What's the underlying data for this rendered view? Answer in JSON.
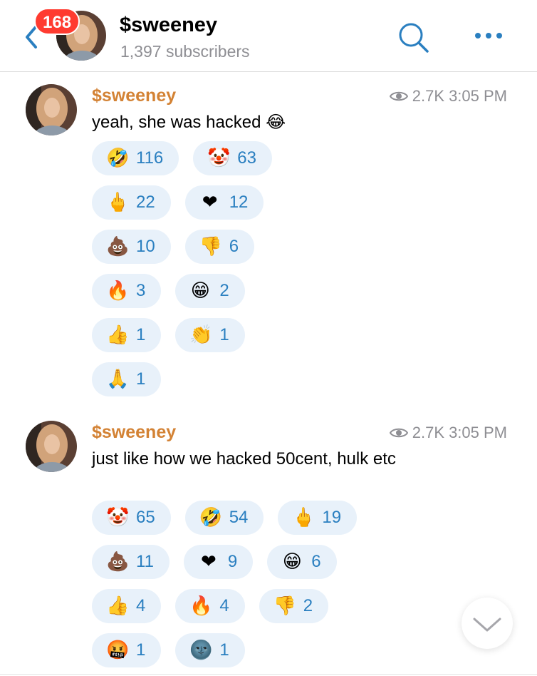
{
  "header": {
    "badge_count": "168",
    "title": "$sweeney",
    "subscribers": "1,397 subscribers"
  },
  "colors": {
    "accent_blue": "#2a7fc0",
    "author_orange": "#d38234",
    "badge_red": "#ff3b30",
    "reaction_bg": "#e8f1fa"
  },
  "messages": [
    {
      "author": "$sweeney",
      "views": "2.7K",
      "time": "3:05 PM",
      "text": "yeah, she was hacked 😂",
      "reactions": [
        [
          {
            "emoji": "🤣",
            "icon": "rofl-icon",
            "count": "116"
          },
          {
            "emoji": "🤡",
            "icon": "clown-icon",
            "count": "63"
          }
        ],
        [
          {
            "emoji": "🖕",
            "icon": "middle-finger-icon",
            "count": "22"
          },
          {
            "emoji": "❤",
            "icon": "heart-icon",
            "count": "12"
          }
        ],
        [
          {
            "emoji": "💩",
            "icon": "poop-icon",
            "count": "10"
          },
          {
            "emoji": "👎",
            "icon": "thumbs-down-icon",
            "count": "6"
          }
        ],
        [
          {
            "emoji": "🔥",
            "icon": "fire-icon",
            "count": "3"
          },
          {
            "emoji": "😁",
            "icon": "grin-icon",
            "count": "2"
          }
        ],
        [
          {
            "emoji": "👍",
            "icon": "thumbs-up-icon",
            "count": "1"
          },
          {
            "emoji": "👏",
            "icon": "clap-icon",
            "count": "1"
          }
        ],
        [
          {
            "emoji": "🙏",
            "icon": "pray-icon",
            "count": "1"
          }
        ]
      ]
    },
    {
      "author": "$sweeney",
      "views": "2.7K",
      "time": "3:05 PM",
      "text": "just like how we hacked 50cent, hulk etc",
      "reactions": [
        [
          {
            "emoji": "🤡",
            "icon": "clown-icon",
            "count": "65"
          },
          {
            "emoji": "🤣",
            "icon": "rofl-icon",
            "count": "54"
          },
          {
            "emoji": "🖕",
            "icon": "middle-finger-icon",
            "count": "19"
          }
        ],
        [
          {
            "emoji": "💩",
            "icon": "poop-icon",
            "count": "11"
          },
          {
            "emoji": "❤",
            "icon": "heart-icon",
            "count": "9"
          },
          {
            "emoji": "😁",
            "icon": "grin-icon",
            "count": "6"
          }
        ],
        [
          {
            "emoji": "👍",
            "icon": "thumbs-up-icon",
            "count": "4"
          },
          {
            "emoji": "🔥",
            "icon": "fire-icon",
            "count": "4"
          },
          {
            "emoji": "👎",
            "icon": "thumbs-down-icon",
            "count": "2"
          }
        ],
        [
          {
            "emoji": "🤬",
            "icon": "cursing-face-icon",
            "count": "1"
          },
          {
            "emoji": "🌚",
            "icon": "new-moon-face-icon",
            "count": "1"
          }
        ]
      ]
    }
  ]
}
